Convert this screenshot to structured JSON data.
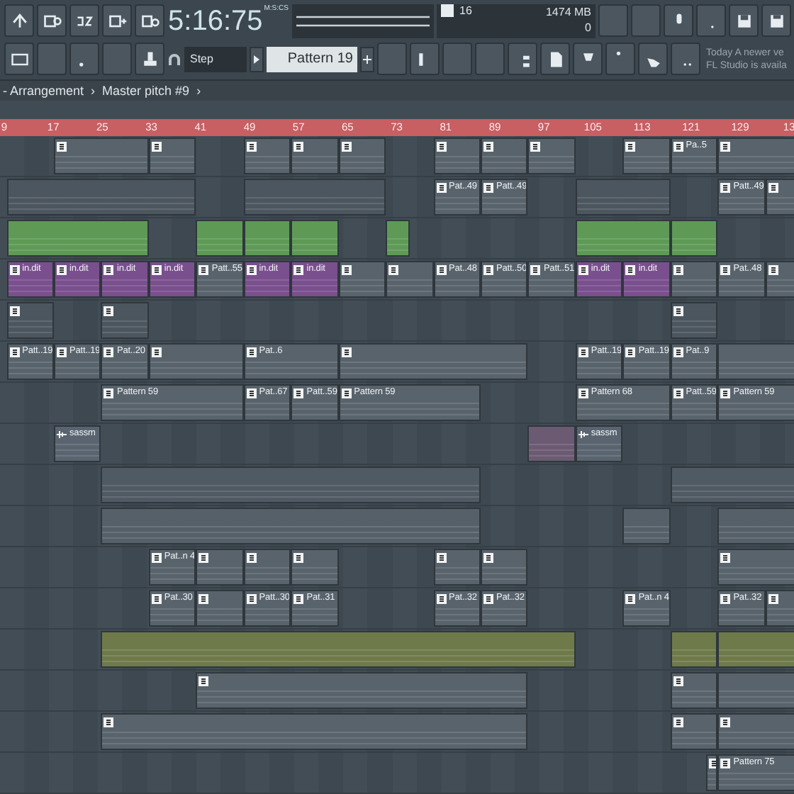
{
  "toolbar": {
    "time": "5:16:75",
    "time_unit": "M:S:CS",
    "cpu_value": "16",
    "memory": "1474 MB",
    "polyphony": "0",
    "snap": "Step",
    "pattern": "Pattern 19",
    "hint_lines": [
      "Today  A newer ve",
      "FL Studio is availa"
    ]
  },
  "breadcrumb": [
    "- Arrangement",
    "›",
    "Master pitch #9",
    "›"
  ],
  "ruler": [
    "9",
    "17",
    "25",
    "33",
    "41",
    "49",
    "57",
    "65",
    "73",
    "81",
    "89",
    "97",
    "105",
    "113",
    "121",
    "129",
    "13"
  ],
  "tracks": [
    {
      "clips": [
        {
          "kind": "pattern",
          "color": "#59636c"
        },
        {
          "kind": "pattern",
          "color": "#59636c"
        },
        {
          "kind": "pattern",
          "color": "#59636c"
        },
        {
          "kind": "pattern",
          "color": "#59636c"
        },
        {
          "kind": "pattern",
          "color": "#59636c"
        },
        {
          "kind": "pattern",
          "color": "#59636c"
        },
        {
          "kind": "pattern",
          "color": "#59636c"
        },
        {
          "kind": "pattern",
          "color": "#59636c"
        },
        {
          "kind": "pattern",
          "color": "#59636c"
        },
        {
          "kind": "pattern",
          "label": "Pa..5",
          "color": "#59636c"
        },
        {
          "kind": "pattern",
          "color": "#59636c"
        }
      ]
    },
    {
      "clips": [
        {
          "kind": "plain",
          "color": "#4c565f"
        },
        {
          "kind": "plain",
          "color": "#4c565f"
        },
        {
          "kind": "pattern",
          "label": "Pat..49",
          "color": "#59636c"
        },
        {
          "kind": "pattern",
          "label": "Patt..49",
          "color": "#59636c"
        },
        {
          "kind": "plain",
          "color": "#4c565f"
        },
        {
          "kind": "pattern",
          "label": "Patt..49",
          "color": "#59636c"
        },
        {
          "kind": "pattern",
          "color": "#59636c"
        }
      ]
    },
    {
      "clips": [
        {
          "kind": "plain",
          "color": "#5e9a56"
        },
        {
          "kind": "plain",
          "color": "#5e9a56"
        },
        {
          "kind": "plain",
          "color": "#5e9a56"
        },
        {
          "kind": "plain",
          "color": "#5e9a56"
        },
        {
          "kind": "plain",
          "color": "#5e9a56"
        },
        {
          "kind": "plain",
          "color": "#5e9a56"
        },
        {
          "kind": "plain",
          "color": "#5e9a56"
        }
      ]
    },
    {
      "clips": [
        {
          "kind": "pattern",
          "label": "in.dit",
          "color": "#7a4f8e"
        },
        {
          "kind": "pattern",
          "label": "in.dit",
          "color": "#7a4f8e"
        },
        {
          "kind": "pattern",
          "label": "in.dit",
          "color": "#7a4f8e"
        },
        {
          "kind": "pattern",
          "label": "in.dit",
          "color": "#7a4f8e"
        },
        {
          "kind": "pattern",
          "label": "Patt..55",
          "color": "#59636c"
        },
        {
          "kind": "pattern",
          "label": "in.dit",
          "color": "#7a4f8e"
        },
        {
          "kind": "pattern",
          "label": "in.dit",
          "color": "#7a4f8e"
        },
        {
          "kind": "pattern",
          "color": "#59636c"
        },
        {
          "kind": "pattern",
          "color": "#59636c"
        },
        {
          "kind": "pattern",
          "label": "Pat..48",
          "color": "#59636c"
        },
        {
          "kind": "pattern",
          "label": "Patt..50",
          "color": "#59636c"
        },
        {
          "kind": "pattern",
          "label": "Patt..51",
          "color": "#59636c"
        },
        {
          "kind": "pattern",
          "label": "in.dit",
          "color": "#7a4f8e"
        },
        {
          "kind": "pattern",
          "label": "in.dit",
          "color": "#7a4f8e"
        },
        {
          "kind": "pattern",
          "color": "#59636c"
        },
        {
          "kind": "pattern",
          "label": "Pat..48",
          "color": "#59636c"
        },
        {
          "kind": "pattern",
          "color": "#59636c"
        }
      ]
    },
    {
      "clips": [
        {
          "kind": "pattern",
          "color": "#4c565f"
        },
        {
          "kind": "pattern",
          "color": "#4c565f"
        },
        {
          "kind": "pattern",
          "color": "#4c565f"
        }
      ]
    },
    {
      "clips": [
        {
          "kind": "pattern",
          "label": "Patt..19",
          "color": "#59636c"
        },
        {
          "kind": "pattern",
          "label": "Patt..19",
          "color": "#59636c"
        },
        {
          "kind": "pattern",
          "label": "Pat..20",
          "color": "#59636c"
        },
        {
          "kind": "pattern",
          "color": "#59636c"
        },
        {
          "kind": "pattern",
          "label": "Pat..6",
          "color": "#59636c"
        },
        {
          "kind": "pattern",
          "color": "#59636c"
        },
        {
          "kind": "pattern",
          "label": "Patt..19",
          "color": "#59636c"
        },
        {
          "kind": "pattern",
          "label": "Patt..19",
          "color": "#59636c"
        },
        {
          "kind": "pattern",
          "label": "Pat..9",
          "color": "#59636c"
        },
        {
          "kind": "plain",
          "color": "#59636c"
        }
      ]
    },
    {
      "clips": [
        {
          "kind": "pattern",
          "label": "Pattern 59",
          "color": "#59636c"
        },
        {
          "kind": "pattern",
          "label": "Pat..67",
          "color": "#59636c"
        },
        {
          "kind": "pattern",
          "label": "Patt..59",
          "color": "#59636c"
        },
        {
          "kind": "pattern",
          "label": "Pattern 59",
          "color": "#59636c"
        },
        {
          "kind": "pattern",
          "label": "Pattern 68",
          "color": "#59636c"
        },
        {
          "kind": "pattern",
          "label": "Patt..59",
          "color": "#59636c"
        },
        {
          "kind": "pattern",
          "label": "Pattern 59",
          "color": "#59636c"
        }
      ]
    },
    {
      "clips": [
        {
          "kind": "audio",
          "label": "sassm",
          "color": "#5a6470"
        },
        {
          "kind": "plain",
          "color": "#6b5a72"
        },
        {
          "kind": "audio",
          "label": "sassm",
          "color": "#5a6470"
        }
      ]
    },
    {
      "clips": [
        {
          "kind": "plain",
          "color": "#4f5a63"
        },
        {
          "kind": "plain",
          "color": "#4f5a63"
        }
      ]
    },
    {
      "clips": [
        {
          "kind": "plain",
          "color": "#566069"
        },
        {
          "kind": "plain",
          "color": "#566069"
        },
        {
          "kind": "plain",
          "color": "#566069"
        }
      ]
    },
    {
      "clips": [
        {
          "kind": "pattern",
          "label": "Pat..n 4",
          "color": "#59636c"
        },
        {
          "kind": "pattern",
          "color": "#59636c"
        },
        {
          "kind": "pattern",
          "color": "#59636c"
        },
        {
          "kind": "pattern",
          "color": "#59636c"
        },
        {
          "kind": "pattern",
          "color": "#59636c"
        },
        {
          "kind": "pattern",
          "color": "#59636c"
        },
        {
          "kind": "pattern",
          "color": "#59636c"
        }
      ]
    },
    {
      "clips": [
        {
          "kind": "pattern",
          "label": "Pat..30",
          "color": "#59636c"
        },
        {
          "kind": "pattern",
          "color": "#59636c"
        },
        {
          "kind": "pattern",
          "label": "Patt..30",
          "color": "#59636c"
        },
        {
          "kind": "pattern",
          "label": "Pat..31",
          "color": "#59636c"
        },
        {
          "kind": "pattern",
          "label": "Pat..32",
          "color": "#59636c"
        },
        {
          "kind": "pattern",
          "label": "Pat..32",
          "color": "#59636c"
        },
        {
          "kind": "pattern",
          "label": "Pat..n 4",
          "color": "#59636c"
        },
        {
          "kind": "pattern",
          "label": "Pat..32",
          "color": "#59636c"
        },
        {
          "kind": "pattern",
          "color": "#59636c"
        }
      ]
    },
    {
      "clips": [
        {
          "kind": "plain",
          "color": "#6f7a4a"
        },
        {
          "kind": "plain",
          "color": "#6f7a4a"
        },
        {
          "kind": "plain",
          "color": "#6f7a4a"
        }
      ]
    },
    {
      "clips": [
        {
          "kind": "pattern",
          "color": "#59636c"
        },
        {
          "kind": "pattern",
          "color": "#59636c"
        },
        {
          "kind": "plain",
          "color": "#59636c"
        }
      ]
    },
    {
      "clips": [
        {
          "kind": "pattern",
          "color": "#59636c"
        },
        {
          "kind": "pattern",
          "color": "#59636c"
        },
        {
          "kind": "pattern",
          "color": "#59636c"
        }
      ]
    },
    {
      "clips": [
        {
          "kind": "pattern",
          "color": "#59636c"
        },
        {
          "kind": "pattern",
          "label": "Pattern 75",
          "color": "#59636c"
        }
      ]
    }
  ]
}
